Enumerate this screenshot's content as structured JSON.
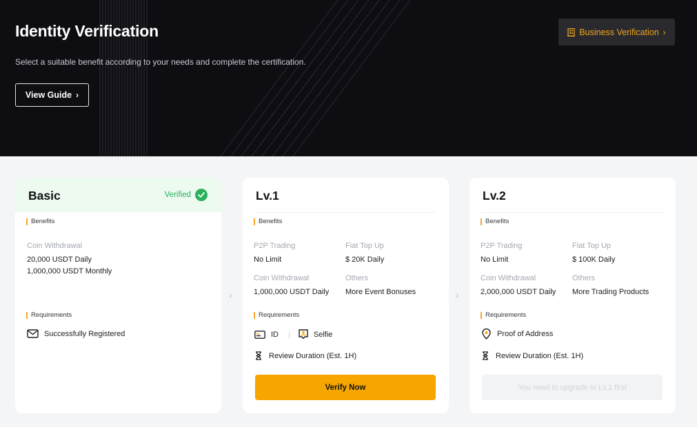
{
  "hero": {
    "title": "Identity Verification",
    "subtitle": "Select a suitable benefit according to your needs and complete the certification.",
    "guide_button": "View Guide",
    "business_button": "Business Verification"
  },
  "colors": {
    "accent": "#f7a600",
    "verified": "#2bb05c",
    "hero_bg": "#0e0e12"
  },
  "basic": {
    "title": "Basic",
    "status": "Verified",
    "benefits_label": "Benefits",
    "withdrawal_label": "Coin Withdrawal",
    "withdrawal_daily": "20,000 USDT Daily",
    "withdrawal_monthly": "1,000,000 USDT Monthly",
    "requirements_label": "Requirements",
    "requirement": "Successfully Registered"
  },
  "lv1": {
    "title": "Lv.1",
    "benefits_label": "Benefits",
    "p2p_label": "P2P Trading",
    "p2p_value": "No Limit",
    "fiat_label": "Fiat Top Up",
    "fiat_value": "$ 20K Daily",
    "withdrawal_label": "Coin Withdrawal",
    "withdrawal_value": "1,000,000 USDT Daily",
    "others_label": "Others",
    "others_value": "More Event Bonuses",
    "requirements_label": "Requirements",
    "req_id": "ID",
    "req_selfie": "Selfie",
    "review": "Review Duration (Est. 1H)",
    "button": "Verify Now"
  },
  "lv2": {
    "title": "Lv.2",
    "benefits_label": "Benefits",
    "p2p_label": "P2P Trading",
    "p2p_value": "No Limit",
    "fiat_label": "Fiat Top Up",
    "fiat_value": "$ 100K Daily",
    "withdrawal_label": "Coin Withdrawal",
    "withdrawal_value": "2,000,000 USDT Daily",
    "others_label": "Others",
    "others_value": "More Trading Products",
    "requirements_label": "Requirements",
    "req_address": "Proof of Address",
    "review": "Review Duration (Est. 1H)",
    "button": "You need to upgrade to Lv.1 first"
  }
}
